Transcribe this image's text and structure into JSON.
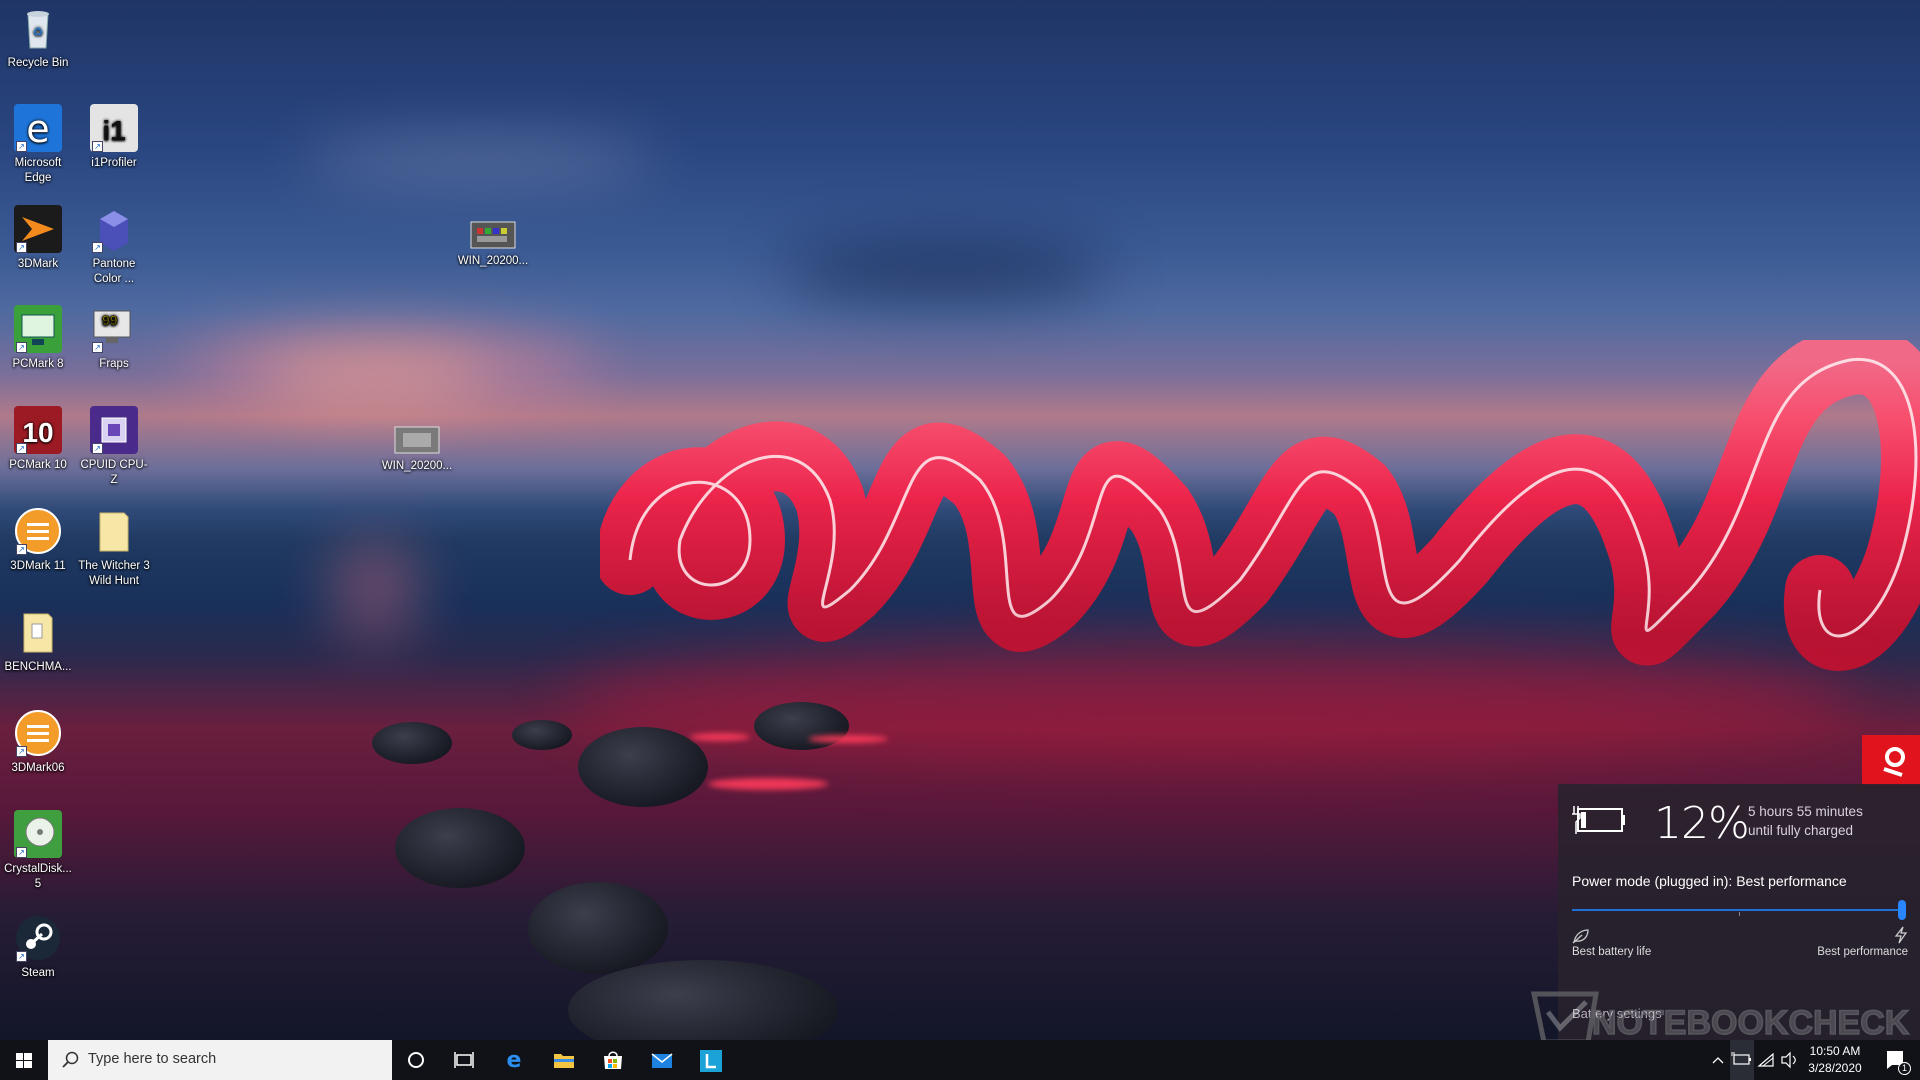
{
  "desktop": {
    "icons": [
      {
        "label": "Recycle Bin",
        "icon": "recycle-bin-icon"
      },
      {
        "label": "Microsoft Edge",
        "icon": "edge-icon"
      },
      {
        "label": "i1Profiler",
        "icon": "i1profiler-icon"
      },
      {
        "label": "3DMark",
        "icon": "3dmark-icon"
      },
      {
        "label": "Pantone Color ...",
        "icon": "pantone-icon"
      },
      {
        "label": "WIN_20200...",
        "icon": "image-file-icon"
      },
      {
        "label": "PCMark 8",
        "icon": "pcmark8-icon"
      },
      {
        "label": "Fraps",
        "icon": "fraps-icon"
      },
      {
        "label": "PCMark 10",
        "icon": "pcmark10-icon"
      },
      {
        "label": "CPUID CPU-Z",
        "icon": "cpuz-icon"
      },
      {
        "label": "WIN_20200...",
        "icon": "image-file-icon"
      },
      {
        "label": "3DMark 11",
        "icon": "3dmark11-icon"
      },
      {
        "label": "The Witcher 3 Wild Hunt",
        "icon": "folder-icon"
      },
      {
        "label": "BENCHMA...",
        "icon": "folder-icon"
      },
      {
        "label": "3DMark06",
        "icon": "3dmark06-icon"
      },
      {
        "label": "CrystalDisk... 5",
        "icon": "crystaldisk-icon"
      },
      {
        "label": "Steam",
        "icon": "steam-icon"
      }
    ]
  },
  "battery_flyout": {
    "percent": "12%",
    "level": 0.12,
    "time_line1": "5 hours 55 minutes",
    "time_line2": "until fully charged",
    "power_mode": "Power mode (plugged in): Best performance",
    "slider_value": 1.0,
    "left_label": "Best battery life",
    "right_label": "Best performance",
    "settings_link": "Battery settings"
  },
  "watermark": {
    "text": "NOTEBOOKCHECK"
  },
  "taskbar": {
    "search_placeholder": "Type here to search",
    "pinned": [
      "cortana-icon",
      "task-view-icon",
      "edge-icon",
      "file-explorer-icon",
      "store-icon",
      "mail-icon",
      "lenovo-l-icon"
    ],
    "time": "10:50 AM",
    "date": "3/28/2020",
    "notification_count": "1"
  },
  "colors": {
    "accent": "#1f6fd8",
    "taskbar": "#101218",
    "flyout": "#28222c"
  }
}
